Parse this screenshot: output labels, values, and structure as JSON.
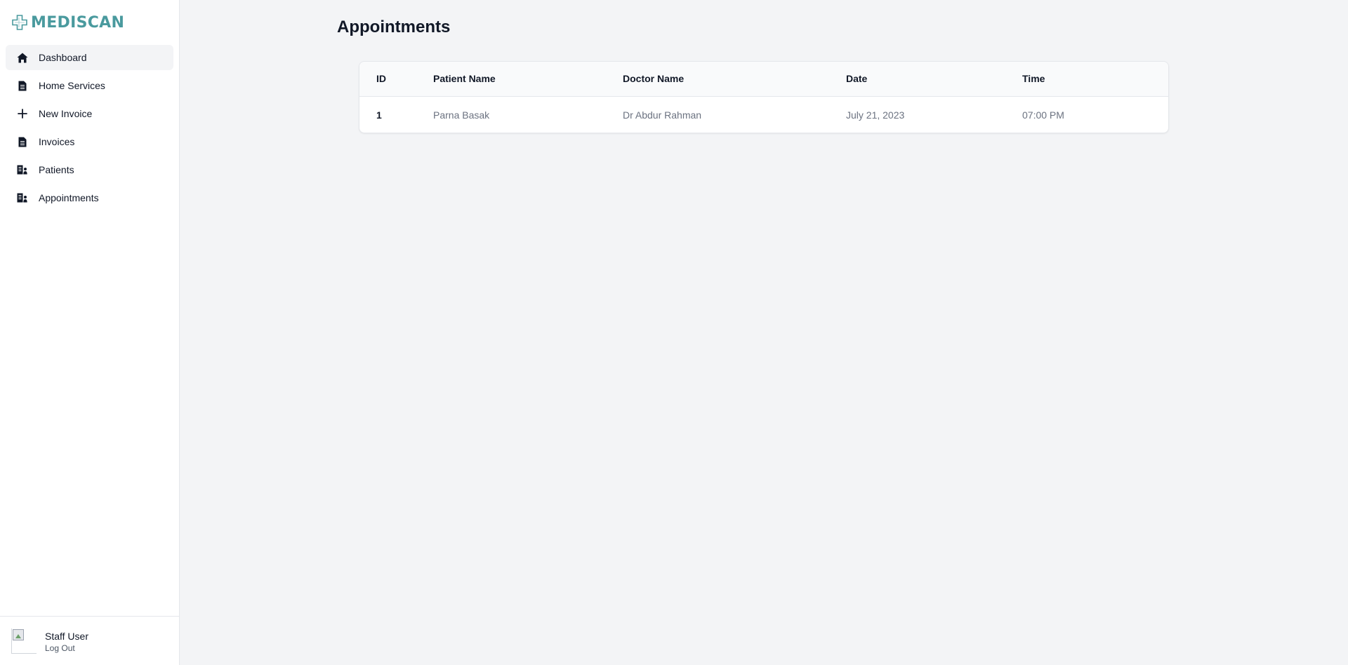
{
  "brand": {
    "name": "MEDISCAN",
    "color": "#4a9a9e",
    "icon": "medical-cross-icon"
  },
  "sidebar": {
    "items": [
      {
        "label": "Dashboard",
        "icon": "home-icon",
        "active": true
      },
      {
        "label": "Home Services",
        "icon": "document-icon",
        "active": false
      },
      {
        "label": "New Invoice",
        "icon": "plus-icon",
        "active": false
      },
      {
        "label": "Invoices",
        "icon": "document-icon",
        "active": false
      },
      {
        "label": "Patients",
        "icon": "id-card-icon",
        "active": false
      },
      {
        "label": "Appointments",
        "icon": "id-card-icon",
        "active": false
      }
    ]
  },
  "user": {
    "name": "Staff User",
    "logout_label": "Log Out",
    "avatar_icon": "broken-image-icon"
  },
  "main": {
    "title": "Appointments",
    "table": {
      "columns": [
        "ID",
        "Patient Name",
        "Doctor Name",
        "Date",
        "Time"
      ],
      "rows": [
        [
          "1",
          "Parna Basak",
          "Dr Abdur Rahman",
          "July 21, 2023",
          "07:00 PM"
        ]
      ]
    }
  }
}
